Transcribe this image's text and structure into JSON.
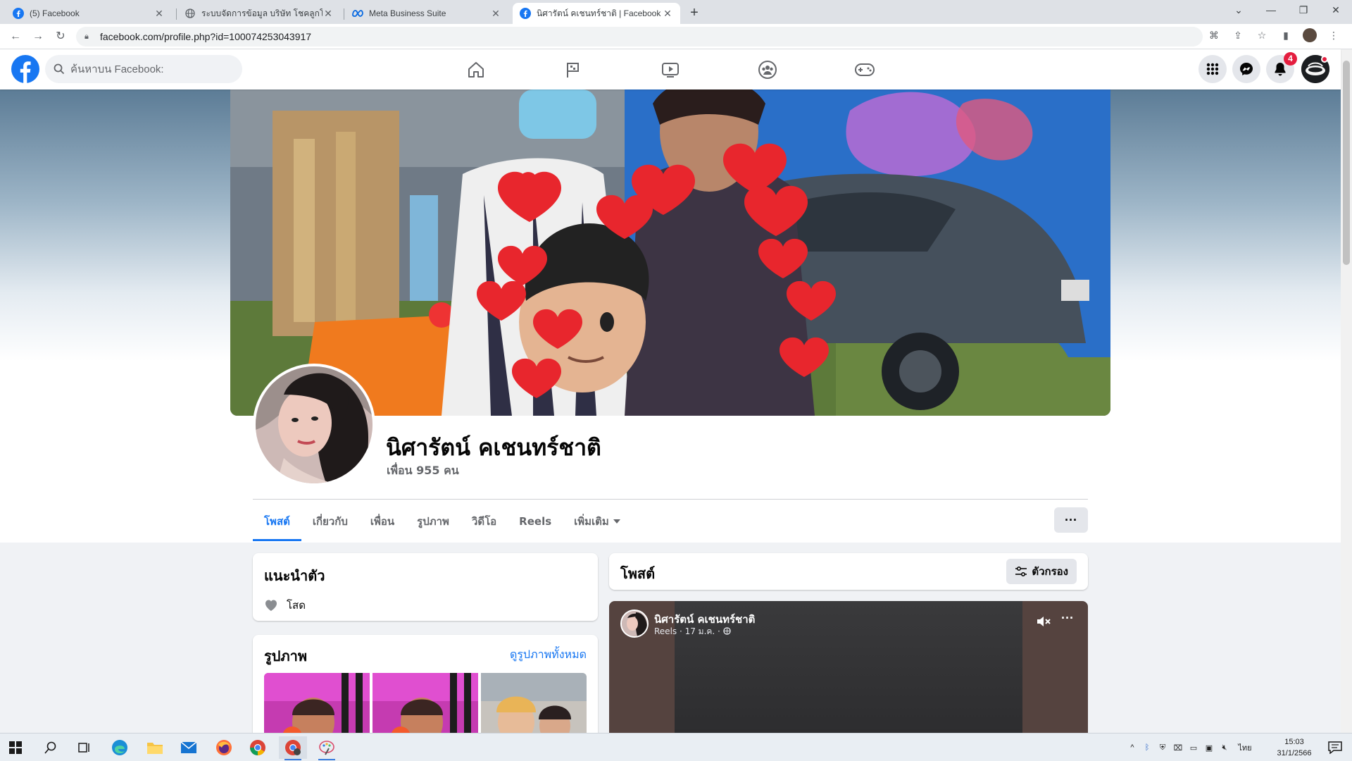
{
  "browser": {
    "tabs": [
      {
        "title": "(5) Facebook",
        "icon": "facebook-icon"
      },
      {
        "title": "ระบบจัดการข้อมูล บริษัท โชคลูกโชค",
        "icon": "globe-icon"
      },
      {
        "title": "Meta Business Suite",
        "icon": "meta-icon"
      },
      {
        "title": "นิศารัตน์ คเชนทร์ชาติ | Facebook",
        "icon": "facebook-icon"
      }
    ],
    "url": "facebook.com/profile.php?id=100074253043917"
  },
  "facebook": {
    "search_placeholder": "ค้นหาบน Facebook:",
    "notifications_count": "4"
  },
  "profile": {
    "name": "นิศารัตน์ คเชนทร์ชาติ",
    "friends": "เพื่อน 955 คน",
    "tabs": [
      "โพสต์",
      "เกี่ยวกับ",
      "เพื่อน",
      "รูปภาพ",
      "วิดีโอ",
      "Reels",
      "เพิ่มเติม"
    ],
    "active_tab": "โพสต์"
  },
  "intro": {
    "title": "แนะนำตัว",
    "relationship": "โสด"
  },
  "photos": {
    "title": "รูปภาพ",
    "see_all": "ดูรูปภาพทั้งหมด"
  },
  "posts": {
    "title": "โพสต์",
    "filter_label": "ตัวกรอง"
  },
  "reel_post": {
    "author": "นิศารัตน์ คเชนทร์ชาติ",
    "meta": "Reels · 17 ม.ค. ·"
  },
  "taskbar": {
    "language": "ไทย",
    "time": "15:03",
    "date": "31/1/2566"
  },
  "colors": {
    "fb_blue": "#1877f2",
    "background": "#f0f2f5",
    "notification_red": "#e41e3f"
  }
}
